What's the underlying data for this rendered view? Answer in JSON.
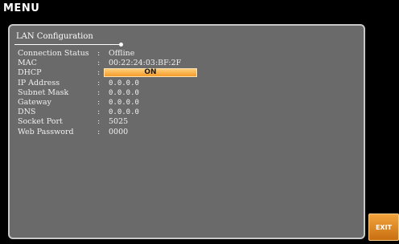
{
  "window": {
    "title": "MENU"
  },
  "lan_config": {
    "header": "LAN Configuration",
    "separator": ":",
    "rows": [
      {
        "label": "Connection Status",
        "value": "Offline"
      },
      {
        "label": "MAC",
        "value": "00:22:24:03:BF:2F"
      },
      {
        "label": "DHCP",
        "value": "ON"
      },
      {
        "label": "IP Address",
        "value": "0.0.0.0"
      },
      {
        "label": "Subnet Mask",
        "value": "0.0.0.0"
      },
      {
        "label": "Gateway",
        "value": "0.0.0.0"
      },
      {
        "label": "DNS",
        "value": "0.0.0.0"
      },
      {
        "label": "Socket Port",
        "value": "5025"
      },
      {
        "label": "Web Password",
        "value": "0000"
      }
    ]
  },
  "buttons": {
    "exit_label": "EXIT"
  },
  "colors": {
    "background": "#000000",
    "panel": "#6a6a6a",
    "panel_border": "#c8c8c8",
    "accent": "#f59b2a",
    "text": "#ffffff"
  }
}
